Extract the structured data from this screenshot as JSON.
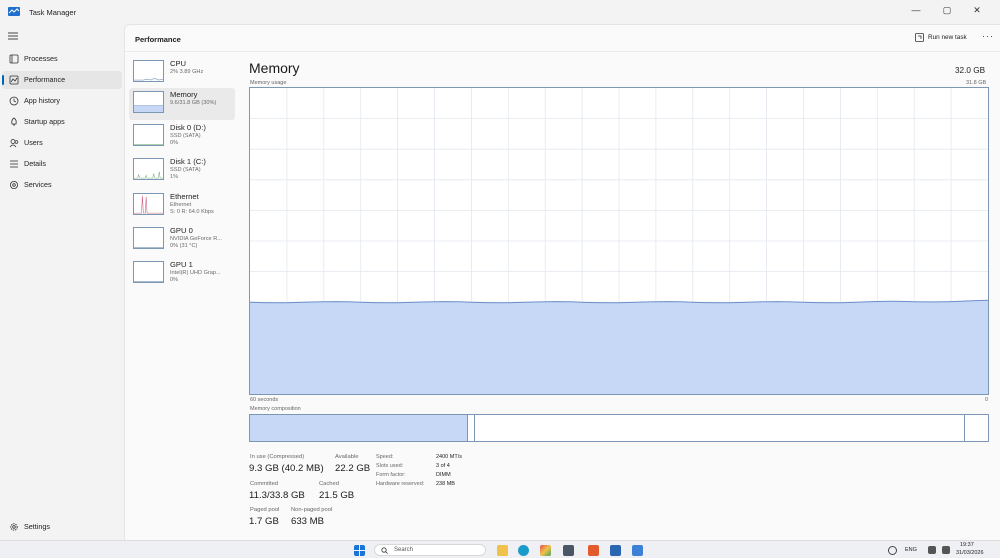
{
  "window": {
    "title": "Task Manager",
    "controls": {
      "minimize": "—",
      "maximize": "▢",
      "close": "✕"
    }
  },
  "nav": {
    "items": [
      {
        "label": "Processes",
        "icon": "processes-icon"
      },
      {
        "label": "Performance",
        "icon": "performance-icon",
        "active": true
      },
      {
        "label": "App history",
        "icon": "app-history-icon"
      },
      {
        "label": "Startup apps",
        "icon": "startup-apps-icon"
      },
      {
        "label": "Users",
        "icon": "users-icon"
      },
      {
        "label": "Details",
        "icon": "details-icon"
      },
      {
        "label": "Services",
        "icon": "services-icon"
      }
    ],
    "settings_label": "Settings"
  },
  "header": {
    "title": "Performance",
    "run_new_task": "Run new task",
    "more": "···"
  },
  "resources": [
    {
      "name": "CPU",
      "sub1": "2% 3.89 GHz",
      "sub2": "",
      "graph": "cpu"
    },
    {
      "name": "Memory",
      "sub1": "9.6/31.8 GB (30%)",
      "sub2": "",
      "graph": "memory",
      "active": true
    },
    {
      "name": "Disk 0 (D:)",
      "sub1": "SSD (SATA)",
      "sub2": "0%",
      "graph": "flat"
    },
    {
      "name": "Disk 1 (C:)",
      "sub1": "SSD (SATA)",
      "sub2": "1%",
      "graph": "disk1"
    },
    {
      "name": "Ethernet",
      "sub1": "Ethernet",
      "sub2": "S: 0 R: 64.0 Kbps",
      "graph": "ethernet"
    },
    {
      "name": "GPU 0",
      "sub1": "NVIDIA GeForce R...",
      "sub2": "0% (31 °C)",
      "graph": "flat"
    },
    {
      "name": "GPU 1",
      "sub1": "Intel(R) UHD Grap...",
      "sub2": "0%",
      "graph": "flat"
    }
  ],
  "memory": {
    "title": "Memory",
    "total": "32.0 GB",
    "graph_label": "Memory usage",
    "graph_max": "31.8 GB",
    "time_left": "60 seconds",
    "time_right": "0",
    "composition_label": "Memory composition",
    "usage_fraction": 0.3,
    "composition": {
      "in_use_fraction": 0.295,
      "standby_end_fraction": 0.968
    },
    "stats": {
      "in_use_label": "In use (Compressed)",
      "in_use_value": "9.3 GB (40.2 MB)",
      "available_label": "Available",
      "available_value": "22.2 GB",
      "committed_label": "Committed",
      "committed_value": "11.3/33.8 GB",
      "cached_label": "Cached",
      "cached_value": "21.5 GB",
      "paged_label": "Paged pool",
      "paged_value": "1.7 GB",
      "nonpaged_label": "Non-paged pool",
      "nonpaged_value": "633 MB"
    },
    "details": [
      {
        "key": "Speed:",
        "value": "2400 MT/s"
      },
      {
        "key": "Slots used:",
        "value": "3 of 4"
      },
      {
        "key": "Form factor:",
        "value": "DIMM"
      },
      {
        "key": "Hardware reserved:",
        "value": "238 MB"
      }
    ]
  },
  "taskbar": {
    "search_placeholder": "Search",
    "language": "ENG",
    "time": "19:37",
    "date": "31/03/2026"
  },
  "colors": {
    "accent": "#0067c0",
    "memory_fill": "#c7d8f6",
    "memory_line": "#6b8fc9",
    "graph_border": "#7c97b6",
    "grid": "#e3e8ef"
  }
}
